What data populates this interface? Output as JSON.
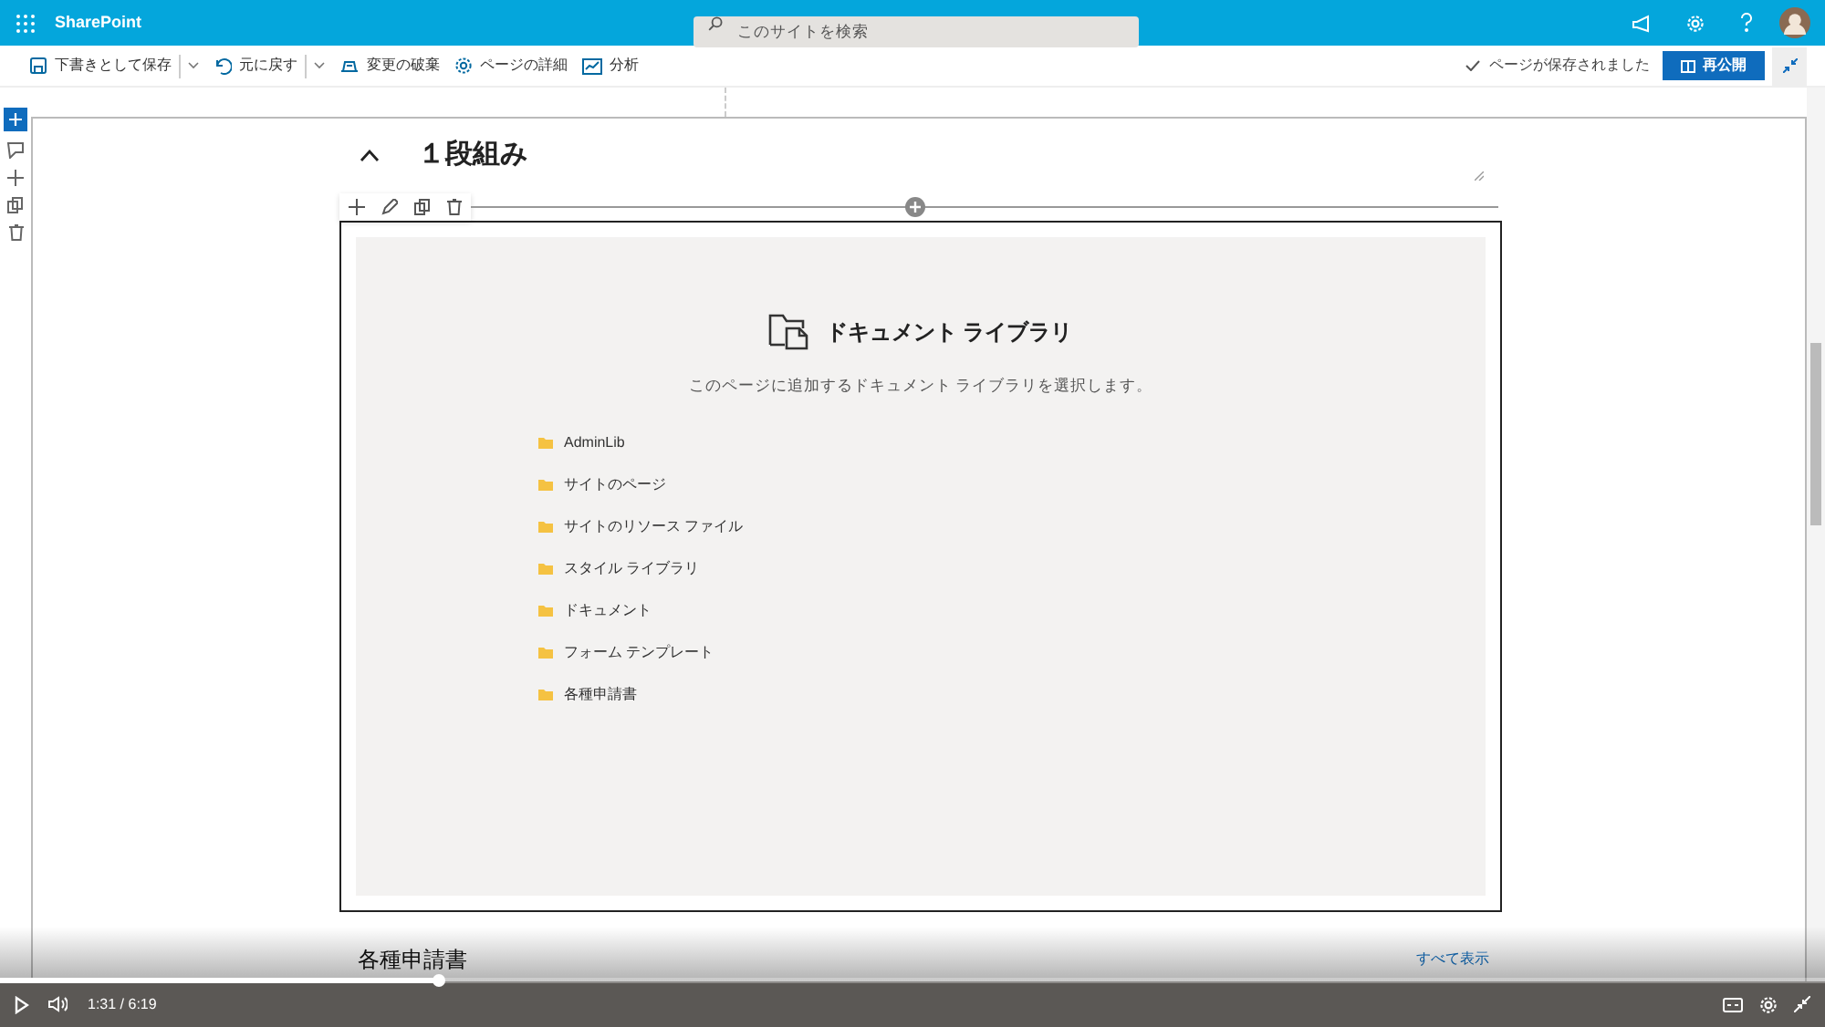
{
  "suite_bar": {
    "app_name": "SharePoint",
    "search": {
      "placeholder": "このサイトを検索"
    }
  },
  "command_bar": {
    "items": [
      {
        "label": "下書きとして保存",
        "kind": "save",
        "dropdown": true
      },
      {
        "label": "元に戻す",
        "kind": "undo",
        "dropdown": true
      },
      {
        "label": "変更の破棄",
        "kind": "discard",
        "dropdown": false
      },
      {
        "label": "ページの詳細",
        "kind": "details",
        "dropdown": false
      },
      {
        "label": "分析",
        "kind": "analytics",
        "dropdown": false
      }
    ],
    "status": "ページが保存されました",
    "publish_button": "再公開"
  },
  "section": {
    "title": "１段組み",
    "expanded": true
  },
  "web_part": {
    "title": "ドキュメント ライブラリ",
    "description": "このページに追加するドキュメント ライブラリを選択します。",
    "libraries": [
      "AdminLib",
      "サイトのページ",
      "サイトのリソース ファイル",
      "スタイル ライブラリ",
      "ドキュメント",
      "フォーム テンプレート",
      "各種申請書"
    ]
  },
  "below": {
    "title": "各種申請書",
    "link": "すべて表示"
  },
  "video": {
    "time": "1:31 / 6:19",
    "level": 0.24
  }
}
